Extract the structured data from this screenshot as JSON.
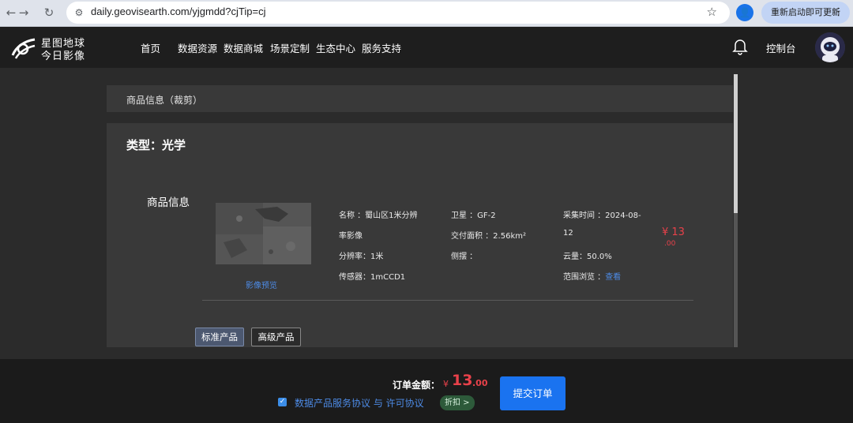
{
  "browser": {
    "url": "daily.geovisearth.com/yjgmdd?cjTip=cj",
    "back_icon": "back-arrow-icon",
    "forward_icon": "forward-arrow-icon",
    "reload_icon": "reload-icon",
    "update_button": "重新启动即可更新"
  },
  "header": {
    "logo_line1": "星图地球",
    "logo_line2": "今日影像",
    "nav": [
      "首页",
      "数据资源",
      "数据商城",
      "场景定制",
      "生态中心",
      "服务支持"
    ],
    "console": "控制台"
  },
  "panel": {
    "title": "商品信息（裁剪）",
    "type_label": "类型：光学",
    "section_label": "商品信息",
    "preview_link": "影像预览",
    "info": {
      "name": "名称 ：蜀山区1米分辨",
      "name_cont": "率影像",
      "resolution": "分辨率：1米",
      "sensor": "传感器：1mCCD1",
      "satellite": "卫星 ：GF-2",
      "area": "交付面积 ：2.56km²",
      "side": "侧摆 ：",
      "time": "采集时间 ：2024-08-",
      "time_cont": "12",
      "cloud": "云量：50.0%",
      "range_label": "范围浏览 ：",
      "range_link": "查看"
    },
    "price_main": "¥ 13",
    "price_cents": ".00",
    "tabs": [
      {
        "label": "标准产品",
        "active": true
      },
      {
        "label": "高级产品",
        "active": false
      }
    ]
  },
  "footer": {
    "order_label": "订单金额：",
    "order_currency": "¥",
    "order_integer": "13",
    "order_cents": ".00",
    "agreement_text": "数据产品服务协议 与 许可协议",
    "agreement_checked": true,
    "discount": "折扣 >",
    "submit": "提交订单"
  },
  "colors": {
    "accent": "#1a73f0",
    "price": "#e8414a",
    "link": "#4d8be6"
  }
}
